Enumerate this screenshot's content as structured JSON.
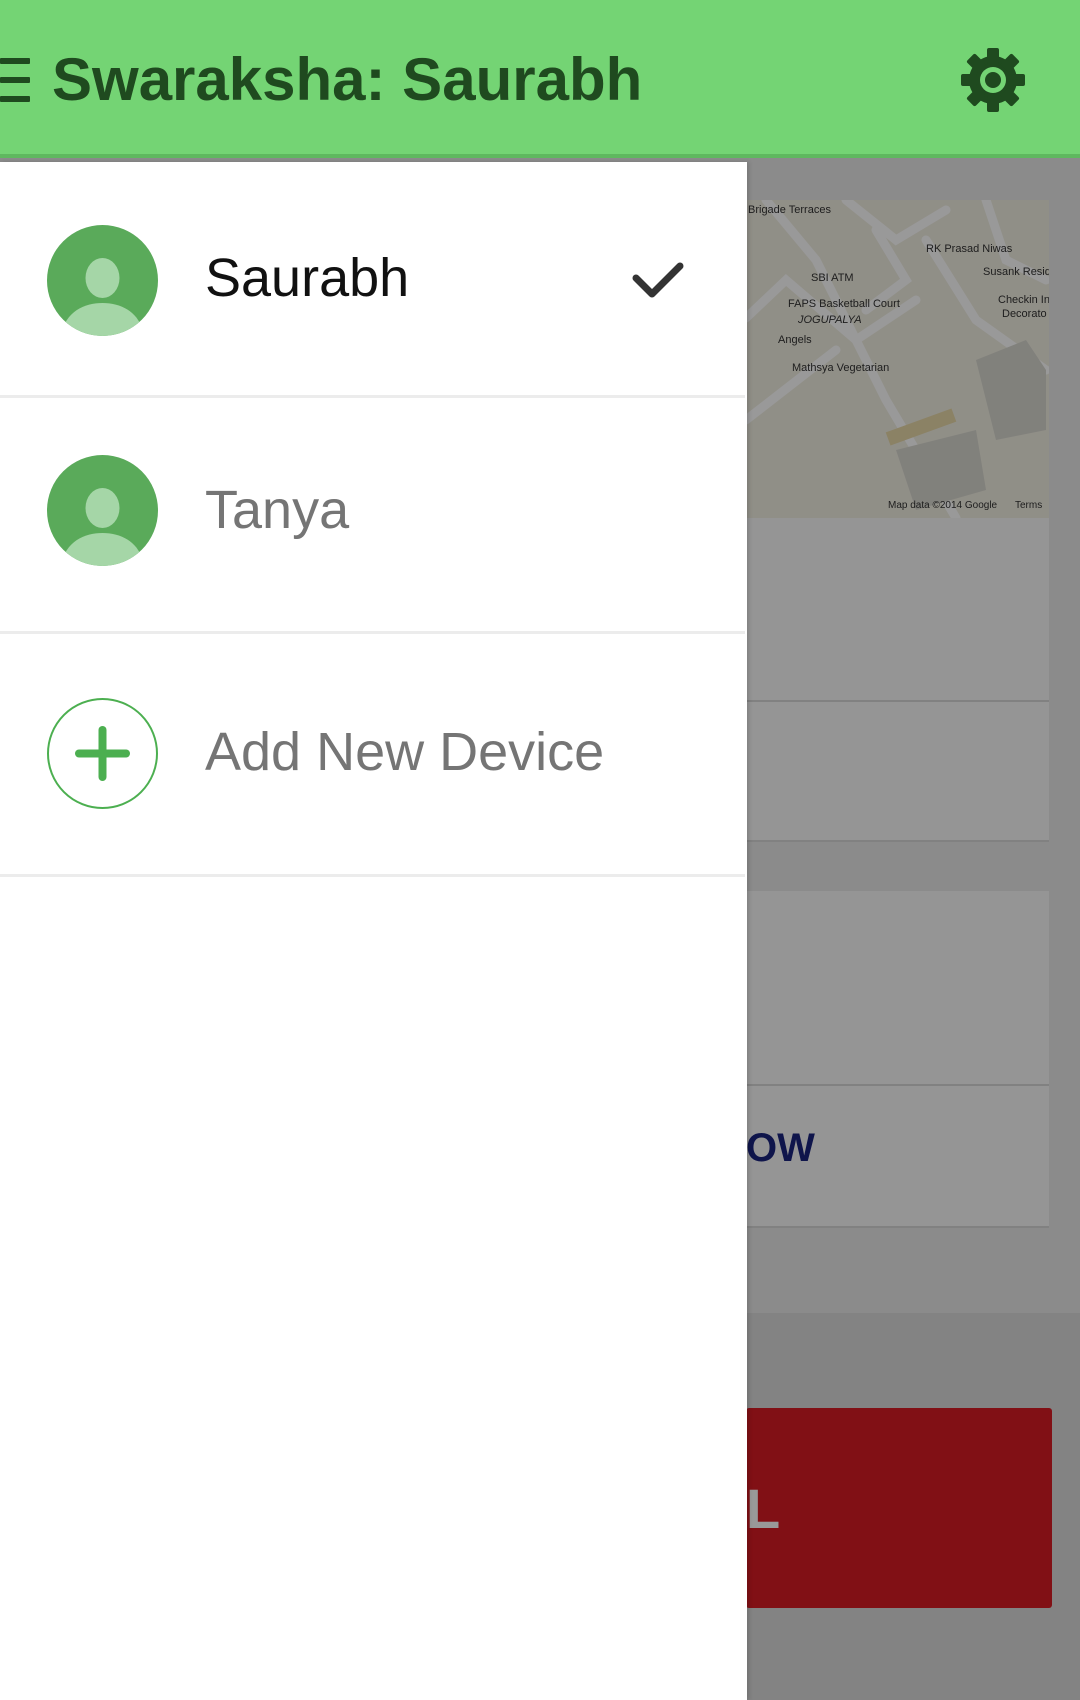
{
  "appbar": {
    "title": "Swaraksha: Saurabh",
    "menu_icon": "hamburger-menu-icon",
    "settings_icon": "gear-icon",
    "color": "#74d474"
  },
  "drawer": {
    "devices": [
      {
        "name": "Saurabh",
        "selected": true,
        "icon": "person-avatar-icon"
      },
      {
        "name": "Tanya",
        "selected": false,
        "icon": "person-avatar-icon"
      }
    ],
    "add_device_label": "Add New Device",
    "add_icon": "plus-circle-icon",
    "check_icon": "checkmark-icon"
  },
  "background": {
    "map": {
      "places": [
        "Brigade Terraces",
        "SBI ATM",
        "FAPS Basketball Court",
        "JOGUPALYA",
        "Angels",
        "Mathsya Vegetarian",
        "RK Prasad Niwas",
        "Susank Residency",
        "Checkin In",
        "Decorato"
      ],
      "attribution": "Map data ©2014 Google",
      "terms": "Terms"
    },
    "partial_text_now": "OW",
    "partial_text_button": "L",
    "alert_color": "#d71c24"
  }
}
